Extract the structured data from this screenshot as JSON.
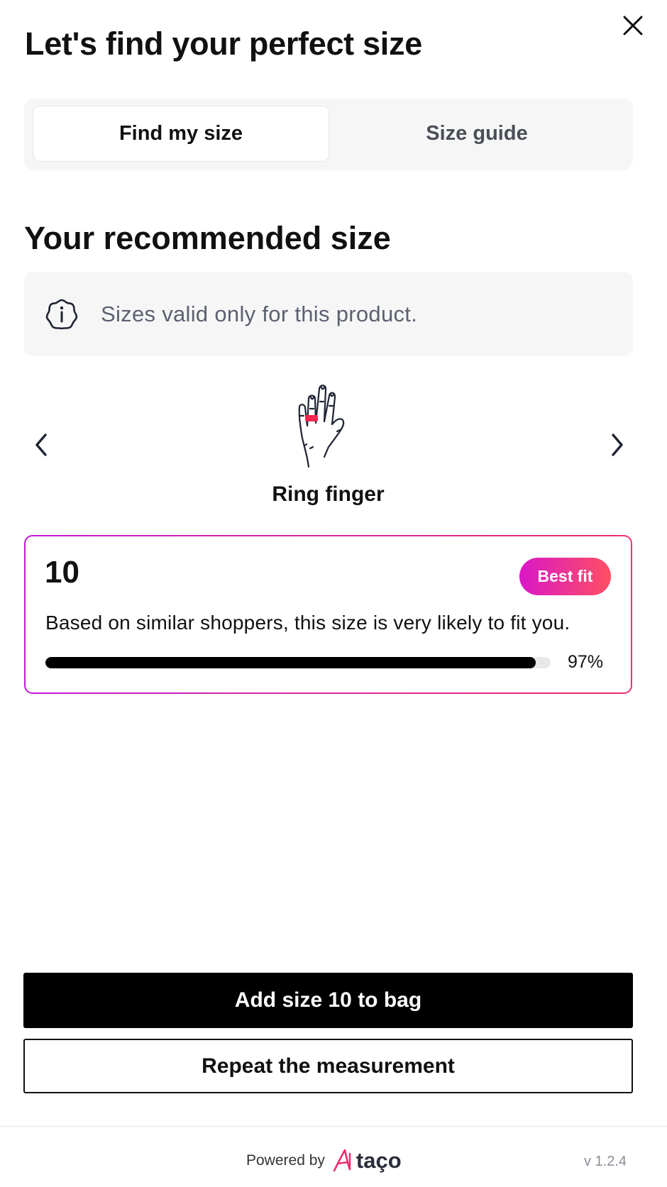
{
  "header": {
    "title": "Let's find your perfect size",
    "close_icon": "close-icon"
  },
  "tabs": [
    {
      "label": "Find my size",
      "active": true
    },
    {
      "label": "Size guide",
      "active": false
    }
  ],
  "recommendation": {
    "title": "Your recommended size",
    "info_icon": "info-icon",
    "info_text": "Sizes valid only for this product."
  },
  "carousel": {
    "prev_icon": "chevron-left-icon",
    "next_icon": "chevron-right-icon",
    "illustration_icon": "hand-ring-finger-icon",
    "finger_label": "Ring finger",
    "highlight_color": "#f2264f"
  },
  "size_card": {
    "size": "10",
    "badge": "Best fit",
    "description": "Based on similar shoppers, this size is very likely to fit you.",
    "fit_percent": 97,
    "fit_percent_label": "97%",
    "border_gradient": [
      "#c21ad6",
      "#f0306a"
    ]
  },
  "actions": {
    "add_to_bag_label": "Add size 10 to bag",
    "repeat_label": "Repeat the measurement"
  },
  "footer": {
    "powered_by": "Powered by",
    "brand": "taço",
    "brand_accent_color": "#f02b70",
    "version": "v 1.2.4"
  }
}
